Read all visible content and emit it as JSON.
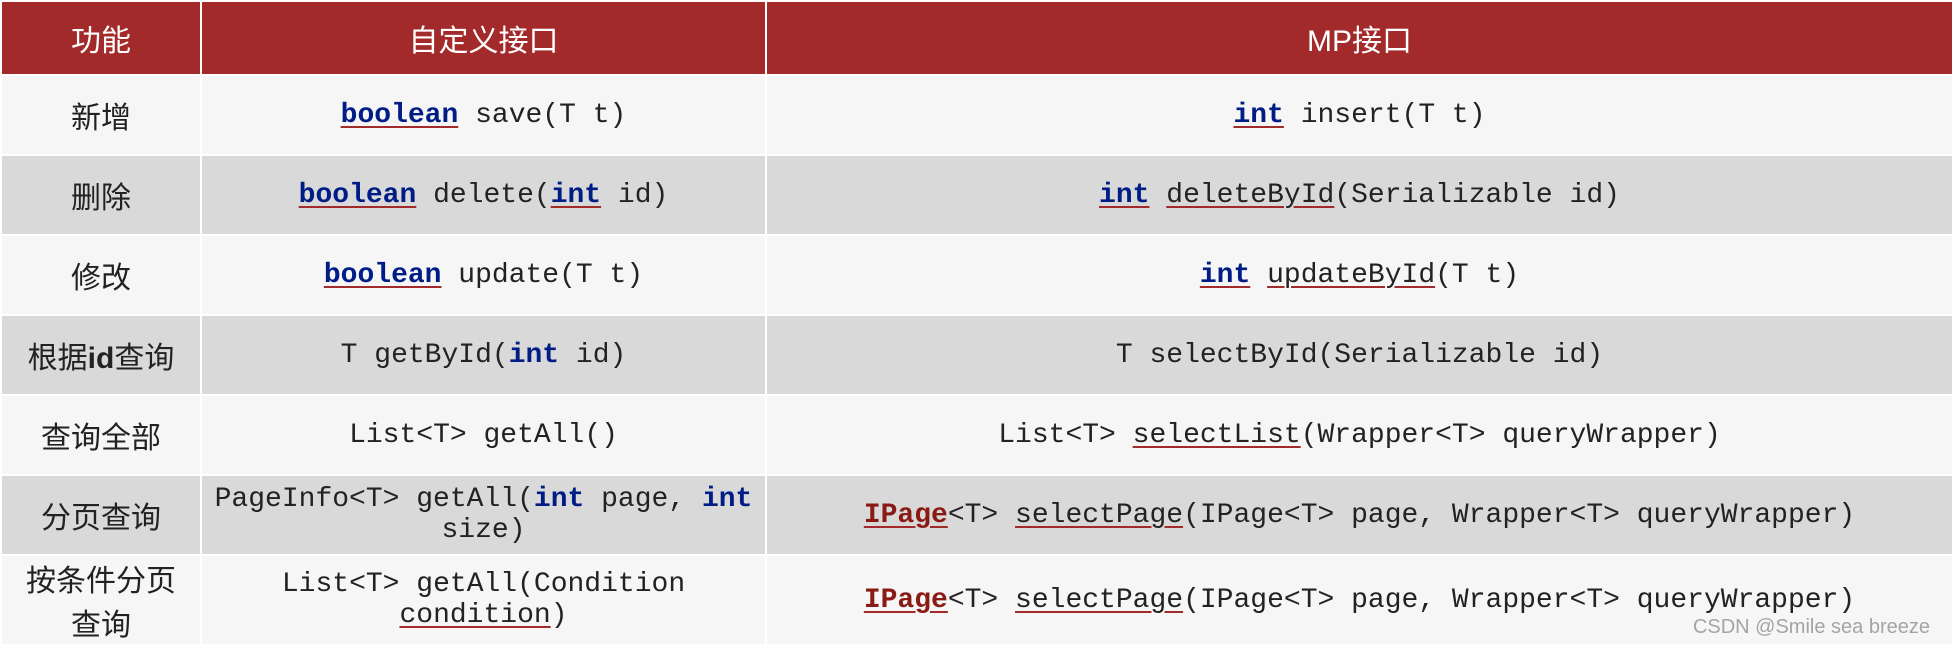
{
  "headers": {
    "c1": "功能",
    "c2": "自定义接口",
    "c3": "MP接口"
  },
  "rows": [
    {
      "feature": "新增",
      "custom": [
        {
          "t": "boolean",
          "c": "kw"
        },
        {
          "t": " save(T t)"
        }
      ],
      "mp": [
        {
          "t": "int",
          "c": "kw"
        },
        {
          "t": " insert(T t)"
        }
      ]
    },
    {
      "feature": "删除",
      "custom": [
        {
          "t": "boolean",
          "c": "kw"
        },
        {
          "t": " delete("
        },
        {
          "t": "int",
          "c": "kw"
        },
        {
          "t": " id)"
        }
      ],
      "mp": [
        {
          "t": "int",
          "c": "kw"
        },
        {
          "t": " "
        },
        {
          "t": "deleteById",
          "c": "mth"
        },
        {
          "t": "(Serializable id)"
        }
      ]
    },
    {
      "feature": "修改",
      "custom": [
        {
          "t": "boolean",
          "c": "kw"
        },
        {
          "t": " update(T t)"
        }
      ],
      "mp": [
        {
          "t": "int",
          "c": "kw"
        },
        {
          "t": " "
        },
        {
          "t": "updateById",
          "c": "mth"
        },
        {
          "t": "(T t)"
        }
      ]
    },
    {
      "feature_html": "根据<span class=\"bold-id\">id</span>查询",
      "custom": [
        {
          "t": "T getById("
        },
        {
          "t": "int",
          "c": "kw2"
        },
        {
          "t": " id)"
        }
      ],
      "mp": [
        {
          "t": "T selectById(Serializable id)"
        }
      ]
    },
    {
      "feature": "查询全部",
      "custom": [
        {
          "t": "List<T> getAll()"
        }
      ],
      "mp": [
        {
          "t": "List<T> "
        },
        {
          "t": "selectList",
          "c": "mth"
        },
        {
          "t": "(Wrapper<T> queryWrapper)"
        }
      ]
    },
    {
      "feature": "分页查询",
      "custom": [
        {
          "t": "PageInfo<T> getAll("
        },
        {
          "t": "int",
          "c": "kw2"
        },
        {
          "t": " page, "
        },
        {
          "t": "int",
          "c": "kw2"
        },
        {
          "t": " size)"
        }
      ],
      "mp": [
        {
          "t": "IPage",
          "c": "cls"
        },
        {
          "t": "<T> "
        },
        {
          "t": "selectPage",
          "c": "mth"
        },
        {
          "t": "(IPage<T> page, Wrapper<T> queryWrapper)"
        }
      ]
    },
    {
      "feature": "按条件分页查询",
      "custom": [
        {
          "t": "List<T> getAll(Condition "
        },
        {
          "t": "condition",
          "c": "mth"
        },
        {
          "t": ")"
        }
      ],
      "mp": [
        {
          "t": "IPage",
          "c": "cls"
        },
        {
          "t": "<T> "
        },
        {
          "t": "selectPage",
          "c": "mth"
        },
        {
          "t": "(IPage<T> page, Wrapper<T> queryWrapper)"
        }
      ]
    }
  ],
  "watermark": "CSDN @Smile sea breeze"
}
